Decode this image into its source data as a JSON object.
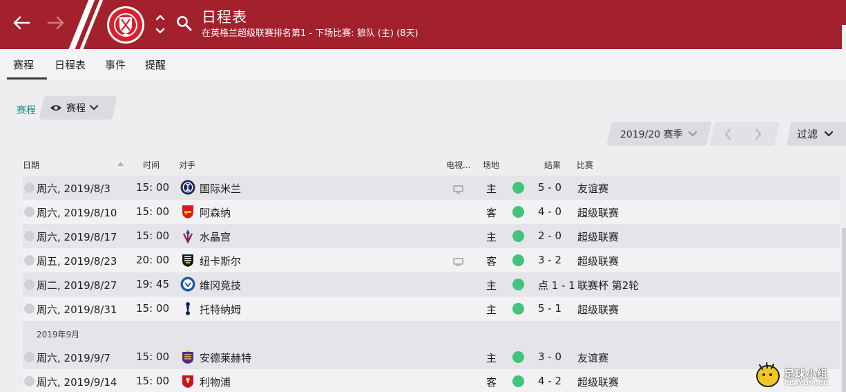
{
  "header": {
    "title": "日程表",
    "subtitle": "在英格兰超级联赛排名第1 - 下场比赛: 狼队 (主) (8天)",
    "bg": "#a3202d"
  },
  "tabs": [
    {
      "label": "赛程",
      "active": true
    },
    {
      "label": "日程表"
    },
    {
      "label": "事件"
    },
    {
      "label": "提醒"
    }
  ],
  "breadcrumb": "赛程",
  "view": {
    "label": "赛程",
    "icon": "eye-icon"
  },
  "season": {
    "label": "2019/20 赛季"
  },
  "filter": {
    "label": "过滤"
  },
  "columns": {
    "date": "日期",
    "time": "时间",
    "opponent": "对手",
    "tv": "电视...",
    "venue": "场地",
    "result": "结果",
    "competition": "比赛"
  },
  "fixtures": [
    {
      "date": "周六, 2019/8/3",
      "time": "15: 00",
      "opponent": "国际米兰",
      "tv": true,
      "venue": "主",
      "result": "5 - 0",
      "competition": "友谊赛",
      "crest": "inter"
    },
    {
      "date": "周六, 2019/8/10",
      "time": "15: 00",
      "opponent": "阿森纳",
      "tv": false,
      "venue": "客",
      "result": "4 - 0",
      "competition": "超级联赛",
      "crest": "arsenal"
    },
    {
      "date": "周六, 2019/8/17",
      "time": "15: 00",
      "opponent": "水晶宫",
      "tv": false,
      "venue": "主",
      "result": "2 - 0",
      "competition": "超级联赛",
      "crest": "palace"
    },
    {
      "date": "周五, 2019/8/23",
      "time": "20: 00",
      "opponent": "纽卡斯尔",
      "tv": true,
      "venue": "客",
      "result": "3 - 2",
      "competition": "超级联赛",
      "crest": "newcastle"
    },
    {
      "date": "周二, 2019/8/27",
      "time": "19: 45",
      "opponent": "维冈竞技",
      "tv": false,
      "venue": "主",
      "result": "点 1 - 1",
      "competition": "联赛杯 第2轮",
      "crest": "wigan"
    },
    {
      "date": "周六, 2019/8/31",
      "time": "15: 00",
      "opponent": "托特纳姆",
      "tv": false,
      "venue": "主",
      "result": "5 - 1",
      "competition": "超级联赛",
      "crest": "spurs"
    },
    {
      "month": "2019年9月"
    },
    {
      "date": "周六, 2019/9/7",
      "time": "15: 00",
      "opponent": "安德莱赫特",
      "tv": false,
      "venue": "主",
      "result": "3 - 0",
      "competition": "友谊赛",
      "crest": "anderlecht"
    },
    {
      "date": "周六, 2019/9/14",
      "time": "15: 00",
      "opponent": "利物浦",
      "tv": false,
      "venue": "客",
      "result": "4 - 2",
      "competition": "超级联赛",
      "crest": "liverpool"
    }
  ],
  "watermark": {
    "main": "足球小组",
    "sub": "PLAYGM.CC",
    "badge": "pps"
  }
}
